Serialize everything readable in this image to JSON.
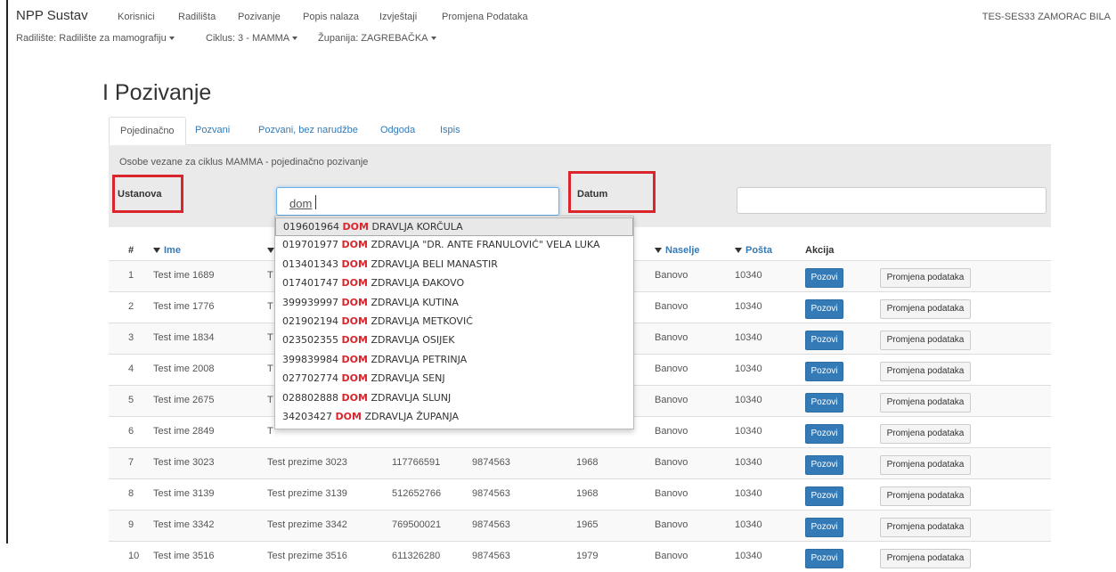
{
  "nav": {
    "brand": "NPP Sustav",
    "items": [
      "Korisnici",
      "Radilišta",
      "Pozivanje",
      "Popis nalaza",
      "Izvještaji",
      "Promjena Podataka"
    ],
    "user": "TES-SES33 ZAMORAC BILA"
  },
  "subbar": {
    "radiliste": "Radilište: Radilište za mamografiju",
    "ciklus": "Ciklus: 3 - MAMMA",
    "zupanija": "Županija: ZAGREBAČKA"
  },
  "page_title": "I Pozivanje",
  "tabs": [
    "Pojedinačno",
    "Pozvani",
    "Pozvani, bez narudžbe",
    "Odgoda",
    "Ispis"
  ],
  "panel": {
    "subtitle": "Osobe vezane za ciklus MAMMA - pojedinačno pozivanje",
    "ustanova_label": "Ustanova",
    "ustanova_value": "dom",
    "datum_label": "Datum",
    "datum_value": ""
  },
  "table": {
    "headers": [
      "#",
      "Ime",
      "Naselje",
      "Pošta",
      "Akcija"
    ],
    "pozovi_label": "Pozovi",
    "promjena_label": "Promjena podataka",
    "rows": [
      {
        "n": "1",
        "ime": "Test ime 1689",
        "prezime": "T",
        "naselje": "Banovo",
        "posta": "10340"
      },
      {
        "n": "2",
        "ime": "Test ime 1776",
        "prezime": "T",
        "naselje": "Banovo",
        "posta": "10340"
      },
      {
        "n": "3",
        "ime": "Test ime 1834",
        "prezime": "T",
        "naselje": "Banovo",
        "posta": "10340"
      },
      {
        "n": "4",
        "ime": "Test ime 2008",
        "prezime": "T",
        "naselje": "Banovo",
        "posta": "10340"
      },
      {
        "n": "5",
        "ime": "Test ime 2675",
        "prezime": "T",
        "naselje": "Banovo",
        "posta": "10340"
      },
      {
        "n": "6",
        "ime": "Test ime 2849",
        "prezime": "T",
        "naselje": "Banovo",
        "posta": "10340"
      },
      {
        "n": "7",
        "ime": "Test ime 3023",
        "prezime": "Test prezime 3023",
        "oib": "117766591",
        "num": "9874563",
        "god": "1968",
        "naselje": "Banovo",
        "posta": "10340"
      },
      {
        "n": "8",
        "ime": "Test ime 3139",
        "prezime": "Test prezime 3139",
        "oib": "512652766",
        "num": "9874563",
        "god": "1968",
        "naselje": "Banovo",
        "posta": "10340"
      },
      {
        "n": "9",
        "ime": "Test ime 3342",
        "prezime": "Test prezime 3342",
        "oib": "769500021",
        "num": "9874563",
        "god": "1965",
        "naselje": "Banovo",
        "posta": "10340"
      },
      {
        "n": "10",
        "ime": "Test ime 3516",
        "prezime": "Test prezime 3516",
        "oib": "611326280",
        "num": "9874563",
        "god": "1979",
        "naselje": "Banovo",
        "posta": "10340"
      }
    ]
  },
  "dropdown": [
    {
      "code": "019601964",
      "match": "DOM",
      "rest": "DRAVLJA KORČULA"
    },
    {
      "code": "019701977",
      "match": "DOM",
      "rest": "ZDRAVLJA \"DR. ANTE FRANULOVIĆ\" VELA LUKA"
    },
    {
      "code": "013401343",
      "match": "DOM",
      "rest": "ZDRAVLJA BELI MANASTIR"
    },
    {
      "code": "017401747",
      "match": "DOM",
      "rest": "ZDRAVLJA ĐAKOVO"
    },
    {
      "code": "399939997",
      "match": "DOM",
      "rest": "ZDRAVLJA KUTINA"
    },
    {
      "code": "021902194",
      "match": "DOM",
      "rest": "ZDRAVLJA METKOVIĆ"
    },
    {
      "code": "023502355",
      "match": "DOM",
      "rest": "ZDRAVLJA OSIJEK"
    },
    {
      "code": "399839984",
      "match": "DOM",
      "rest": "ZDRAVLJA PETRINJA"
    },
    {
      "code": "027702774",
      "match": "DOM",
      "rest": "ZDRAVLJA SENJ"
    },
    {
      "code": "028802888",
      "match": "DOM",
      "rest": "ZDRAVLJA SLUNJ"
    },
    {
      "code": "34203427",
      "match": "DOM",
      "rest": "ZDRAVLJA ŽUPANJA"
    }
  ],
  "colors": {
    "accent": "#337ab7",
    "highlight": "#d9262c"
  }
}
